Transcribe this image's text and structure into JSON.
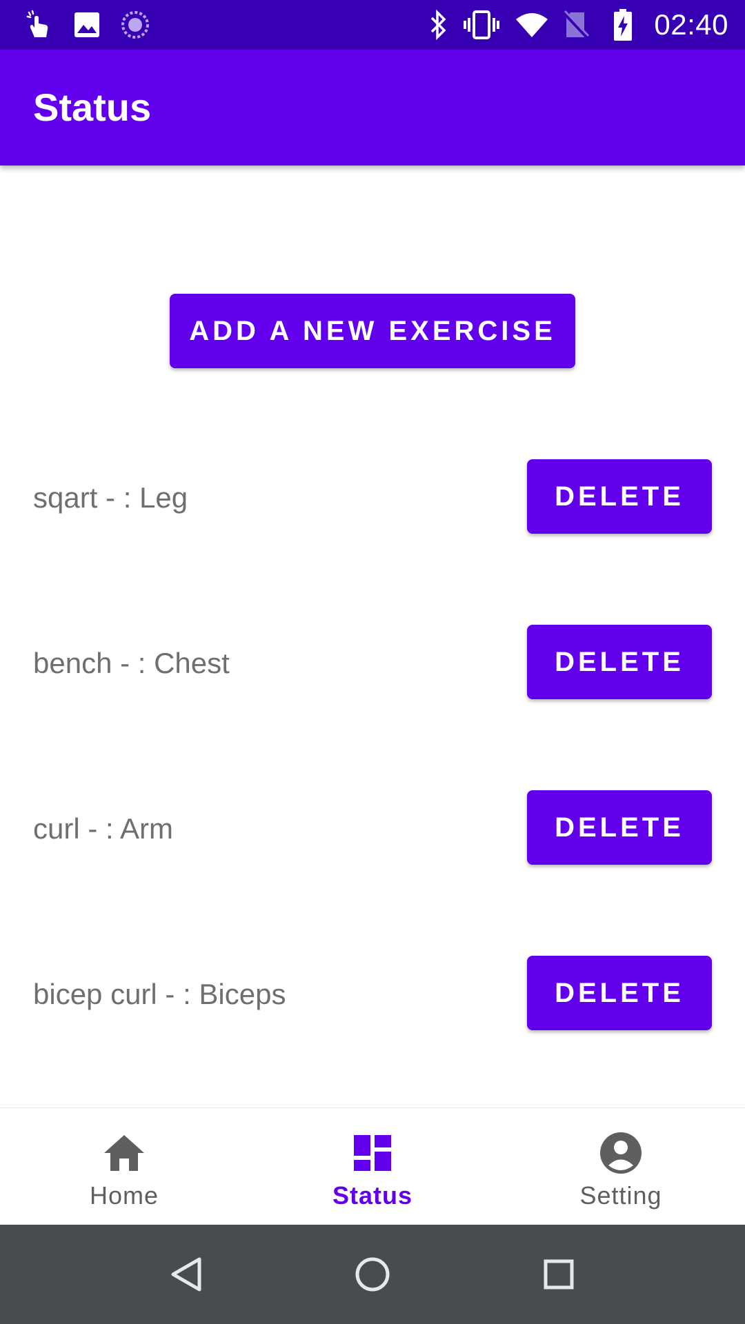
{
  "status_bar": {
    "time": "02:40",
    "left_icons": [
      "touch-icon",
      "image-icon",
      "sync-icon"
    ],
    "right_icons": [
      "bluetooth-icon",
      "vibrate-icon",
      "wifi-icon",
      "no-sim-icon",
      "battery-charging-icon"
    ]
  },
  "app_bar": {
    "title": "Status"
  },
  "main": {
    "add_button_label": "ADD A NEW EXERCISE",
    "exercises": [
      {
        "label": "sqart - : Leg",
        "button_label": "DELETE"
      },
      {
        "label": "bench - : Chest",
        "button_label": "DELETE"
      },
      {
        "label": "curl - : Arm",
        "button_label": "DELETE"
      },
      {
        "label": "bicep curl - : Biceps",
        "button_label": "DELETE"
      }
    ]
  },
  "bottom_nav": {
    "items": [
      {
        "label": "Home",
        "icon": "home-icon",
        "active": false
      },
      {
        "label": "Status",
        "icon": "dashboard-icon",
        "active": true
      },
      {
        "label": "Setting",
        "icon": "account-icon",
        "active": false
      }
    ]
  },
  "system_nav": {
    "buttons": [
      "back-icon",
      "home-circle-icon",
      "recents-icon"
    ]
  },
  "colors": {
    "primary": "#6200EE",
    "primary_dark": "#3700B3",
    "text_secondary": "#6f6f6f",
    "nav_inactive": "#5f5f5f",
    "system_nav_bg": "#474c51"
  }
}
